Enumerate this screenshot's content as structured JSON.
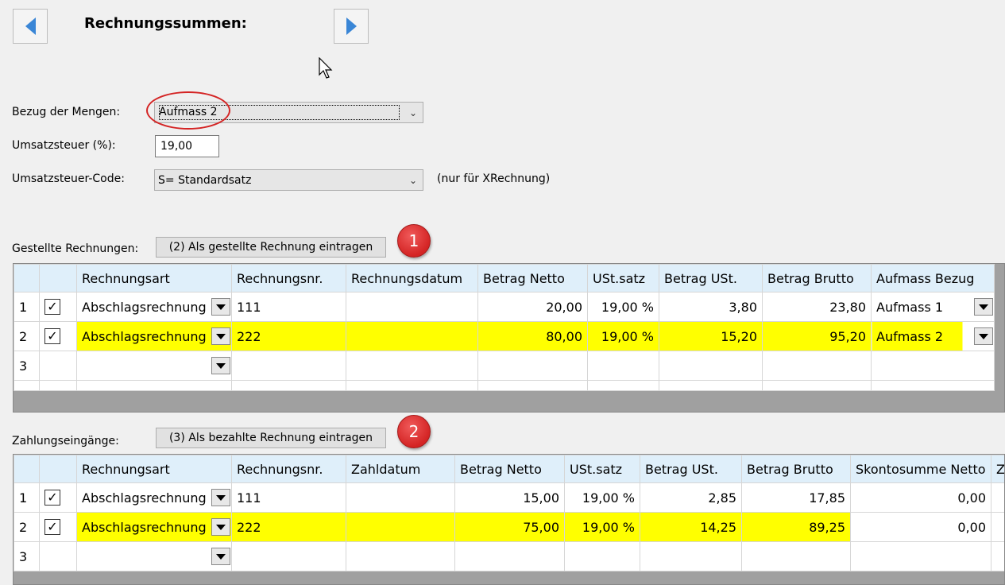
{
  "header": {
    "title": "Rechnungssummen:"
  },
  "form": {
    "bezug_label": "Bezug der Mengen:",
    "bezug_value": "Aufmass 2",
    "ust_label": "Umsatzsteuer (%):",
    "ust_value": "19,00",
    "ust_code_label": "Umsatzsteuer-Code:",
    "ust_code_value": "S= Standardsatz",
    "ust_code_note": "(nur für XRechnung)"
  },
  "invoices": {
    "label": "Gestellte Rechnungen:",
    "button": "(2) Als gestellte Rechnung eintragen",
    "marker": "1",
    "columns": [
      "Rechnungsart",
      "Rechnungsnr.",
      "Rechnungsdatum",
      "Betrag Netto",
      "USt.satz",
      "Betrag USt.",
      "Betrag Brutto",
      "Aufmass Bezug"
    ],
    "rows": [
      {
        "num": "1",
        "art": "Abschlagsrechnung",
        "nr": "111",
        "datum": "",
        "netto": "20,00",
        "satz": "19,00 %",
        "ust": "3,80",
        "brutto": "23,80",
        "bezug": "Aufmass 1"
      },
      {
        "num": "2",
        "art": "Abschlagsrechnung",
        "nr": "222",
        "datum": "",
        "netto": "80,00",
        "satz": "19,00 %",
        "ust": "15,20",
        "brutto": "95,20",
        "bezug": "Aufmass 2"
      },
      {
        "num": "3",
        "art": "",
        "nr": "",
        "datum": "",
        "netto": "",
        "satz": "",
        "ust": "",
        "brutto": "",
        "bezug": ""
      }
    ]
  },
  "payments": {
    "label": "Zahlungseingänge:",
    "button": "(3) Als bezahlte Rechnung eintragen",
    "marker": "2",
    "columns": [
      "Rechnungsart",
      "Rechnungsnr.",
      "Zahldatum",
      "Betrag Netto",
      "USt.satz",
      "Betrag USt.",
      "Betrag Brutto",
      "Skontosumme Netto",
      "Z"
    ],
    "rows": [
      {
        "num": "1",
        "art": "Abschlagsrechnung",
        "nr": "111",
        "datum": "",
        "netto": "15,00",
        "satz": "19,00 %",
        "ust": "2,85",
        "brutto": "17,85",
        "skonto": "0,00"
      },
      {
        "num": "2",
        "art": "Abschlagsrechnung",
        "nr": "222",
        "datum": "",
        "netto": "75,00",
        "satz": "19,00 %",
        "ust": "14,25",
        "brutto": "89,25",
        "skonto": "0,00"
      },
      {
        "num": "3",
        "art": "",
        "nr": "",
        "datum": "",
        "netto": "",
        "satz": "",
        "ust": "",
        "brutto": "",
        "skonto": ""
      }
    ]
  },
  "colors": {
    "highlight": "#ffff00",
    "header_bg": "#dfeffa",
    "marker_red": "#d42424",
    "nav_arrow": "#3a86d6"
  }
}
